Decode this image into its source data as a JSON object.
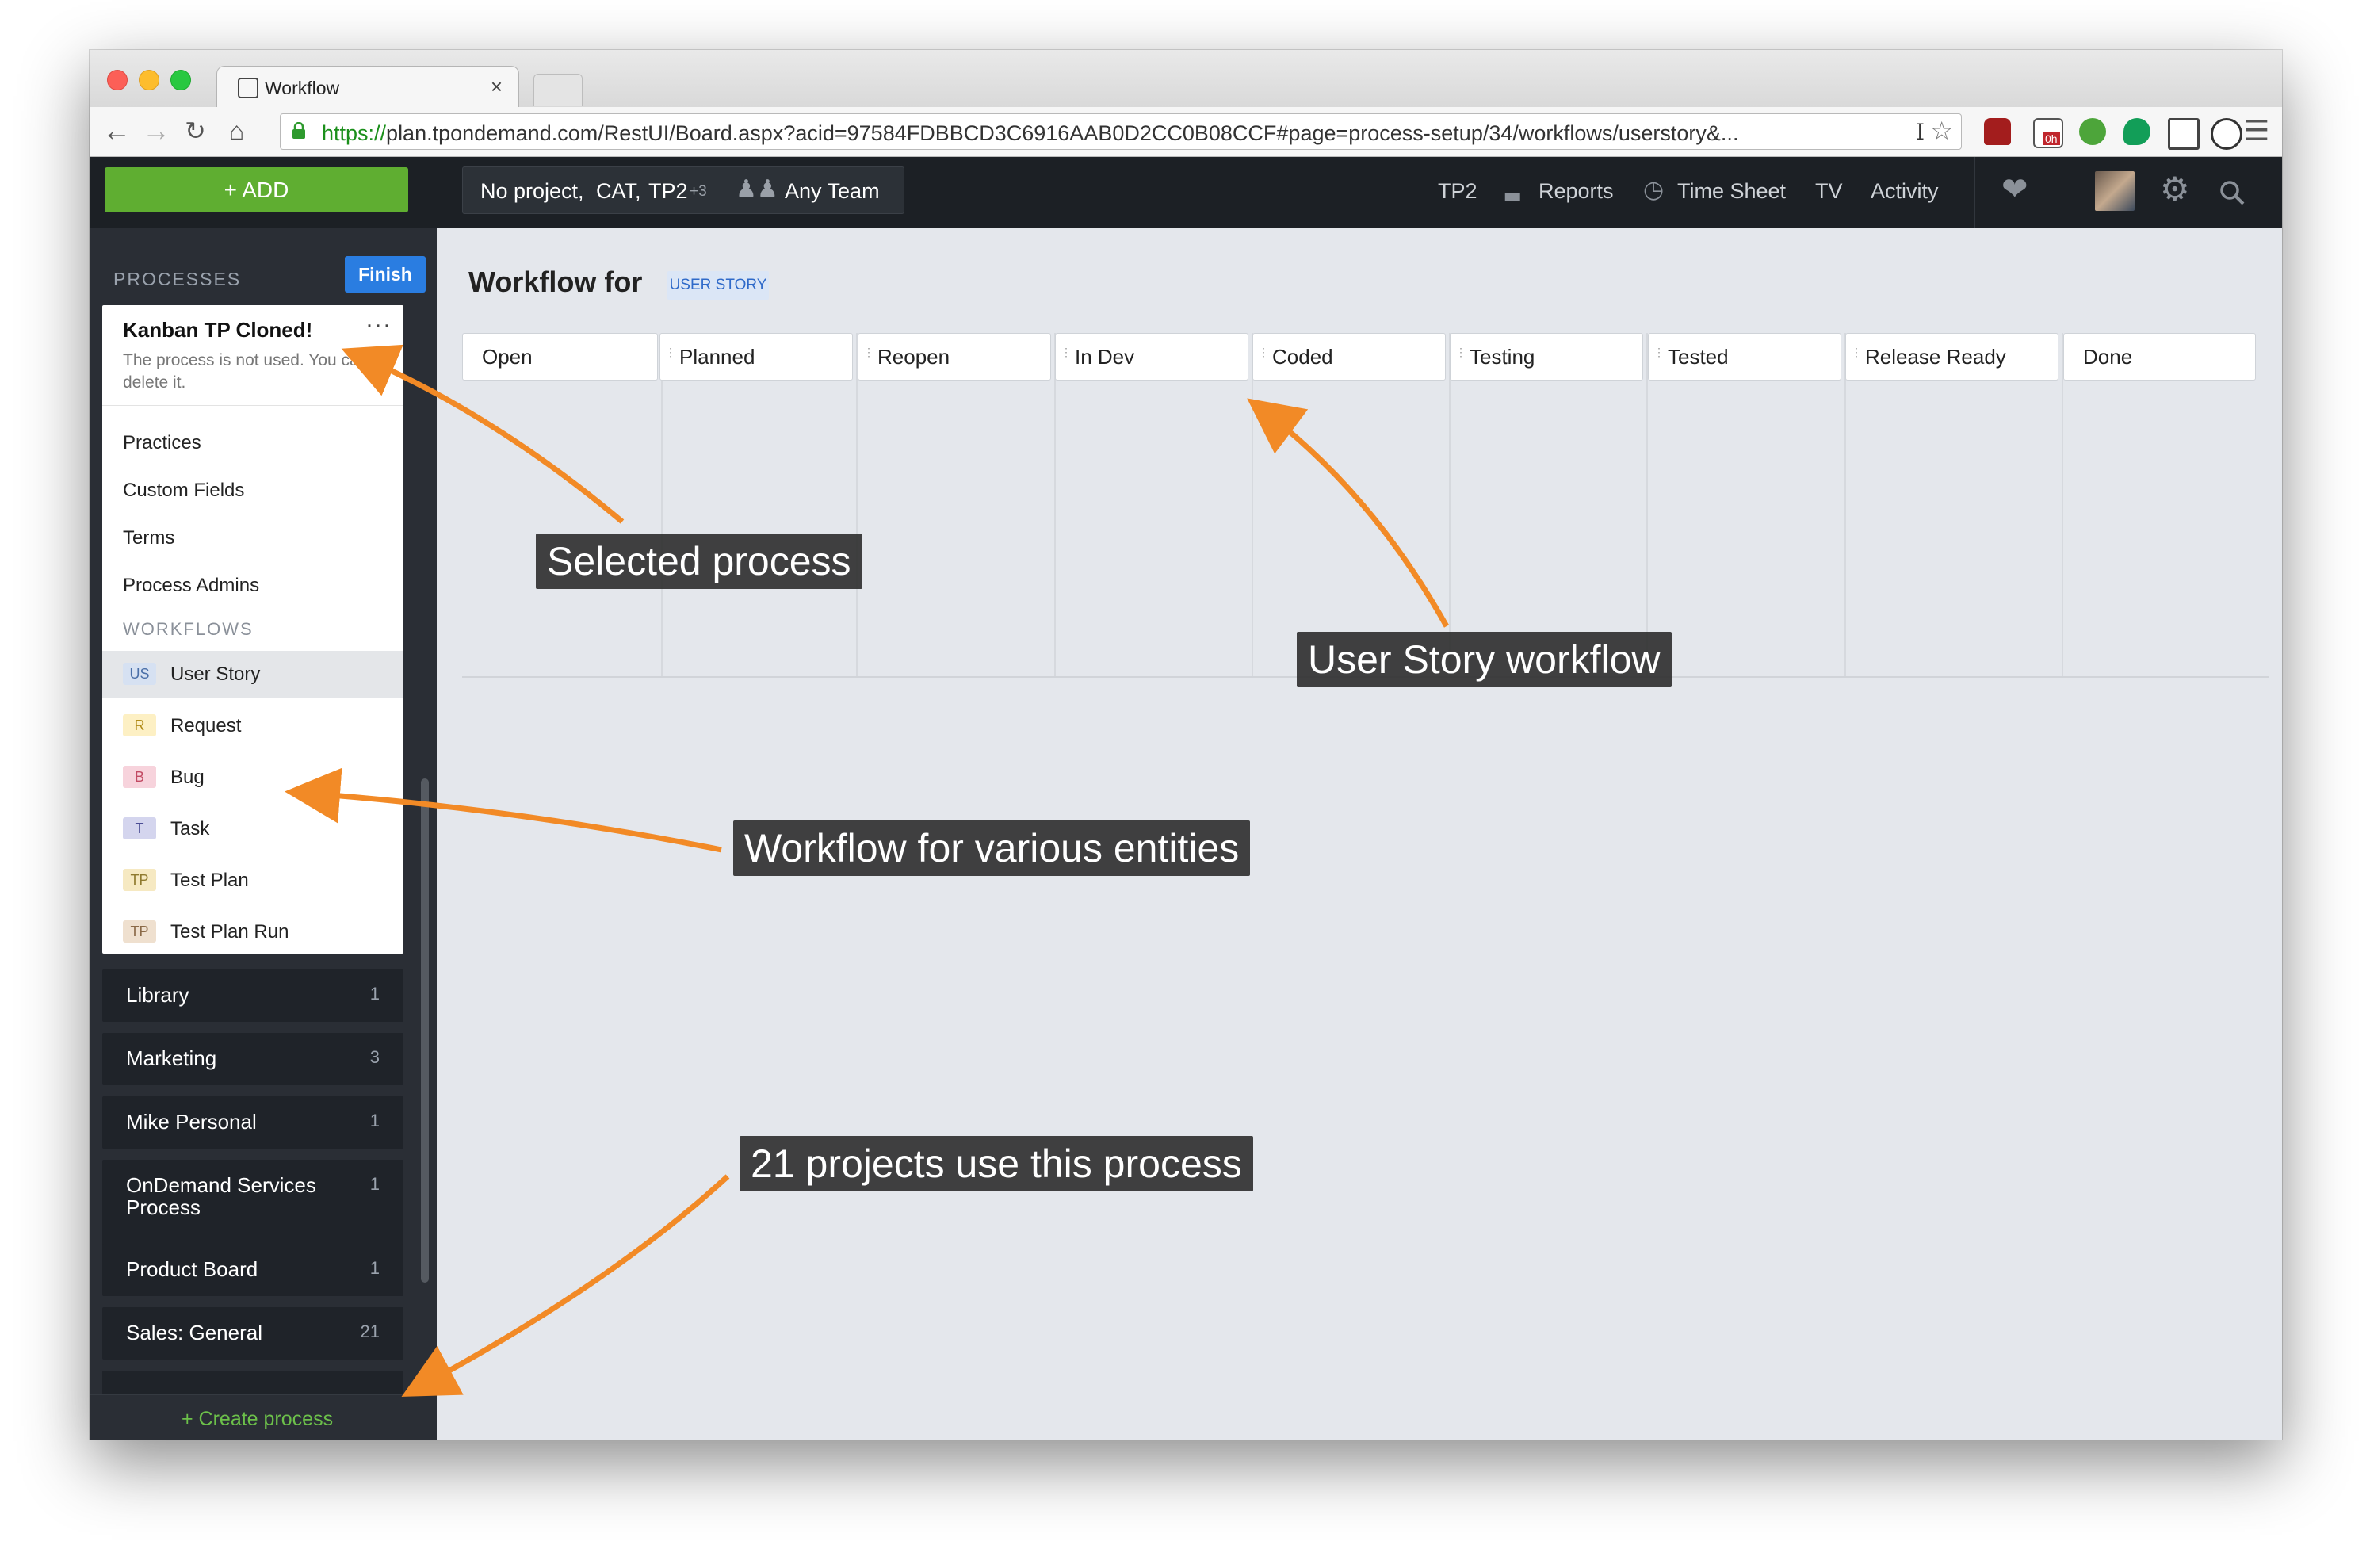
{
  "browser": {
    "tab_title": "Workflow",
    "tab_close": "×",
    "url_proto": "https://",
    "url_rest": "plan.tpondemand.com/RestUI/Board.aspx?acid=97584FDBBCD3C6916AAB0D2CC0B08CCF#page=process-setup/34/workflows/userstory&...",
    "ext_badge": "0h"
  },
  "header": {
    "add_label": "+ ADD",
    "context_project": "No project,",
    "context_cat": "CAT,",
    "context_tp2": "TP2",
    "context_more": "+3",
    "context_team": "Any Team",
    "nav": {
      "tp2": "TP2",
      "reports": "Reports",
      "timesheet": "Time Sheet",
      "tv": "TV",
      "activity": "Activity"
    }
  },
  "sidebar": {
    "processes_heading": "PROCESSES",
    "finish_label": "Finish",
    "selected": {
      "title": "Kanban TP Cloned!",
      "more": "···",
      "subtitle": "The process is not used. You can delete it."
    },
    "menu": [
      "Practices",
      "Custom Fields",
      "Terms",
      "Process Admins"
    ],
    "workflows_heading": "WORKFLOWS",
    "workflows": [
      {
        "badge": "US",
        "label": "User Story",
        "bg": "#d6e1f2",
        "fg": "#4a6fa8"
      },
      {
        "badge": "R",
        "label": "Request",
        "bg": "#fdf0c4",
        "fg": "#b08a16"
      },
      {
        "badge": "B",
        "label": "Bug",
        "bg": "#f7d3dc",
        "fg": "#c24a63"
      },
      {
        "badge": "T",
        "label": "Task",
        "bg": "#d4d5ee",
        "fg": "#4b4d95"
      },
      {
        "badge": "TP",
        "label": "Test Plan",
        "bg": "#f6e9c2",
        "fg": "#8f7a2f"
      },
      {
        "badge": "TP",
        "label": "Test Plan Run",
        "bg": "#efe0cf",
        "fg": "#8b6a48"
      }
    ],
    "processes": [
      {
        "name": "Library",
        "count": "1"
      },
      {
        "name": "Marketing",
        "count": "3"
      },
      {
        "name": "Mike Personal",
        "count": "1"
      },
      {
        "name": "OnDemand Services Process",
        "count": "1"
      },
      {
        "name": "Product Board",
        "count": "1"
      },
      {
        "name": "Sales: General",
        "count": "21"
      }
    ],
    "create_label": "+ Create process"
  },
  "main": {
    "title": "Workflow for",
    "entity_tag": "USER STORY",
    "states": [
      "Open",
      "Planned",
      "Reopen",
      "In Dev",
      "Coded",
      "Testing",
      "Tested",
      "Release Ready",
      "Done"
    ]
  },
  "annotations": {
    "selected_process": "Selected process",
    "user_story_workflow": "User Story workflow",
    "workflow_entities": "Workflow for various entities",
    "projects_use": "21 projects use this process"
  },
  "colors": {
    "add_green": "#5fae31",
    "finish_blue": "#2a7de1",
    "arrow_orange": "#f28a26",
    "header_dark": "#1c2025"
  }
}
